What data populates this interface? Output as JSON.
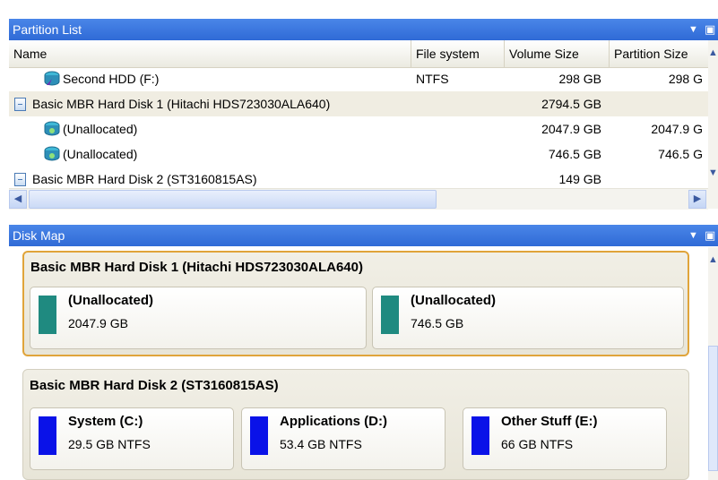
{
  "partition_list": {
    "title": "Partition List",
    "columns": [
      "Name",
      "File system",
      "Volume Size",
      "Partition Size"
    ],
    "rows": [
      {
        "name": "Second HDD (F:)",
        "kind": "partition",
        "fs": "NTFS",
        "volume": "298 GB",
        "partition": "298 G"
      },
      {
        "name": "Basic MBR Hard Disk 1 (Hitachi HDS723030ALA640)",
        "kind": "disk",
        "fs": "",
        "volume": "2794.5 GB",
        "partition": ""
      },
      {
        "name": "(Unallocated)",
        "kind": "partition",
        "fs": "",
        "volume": "2047.9 GB",
        "partition": "2047.9 G"
      },
      {
        "name": "(Unallocated)",
        "kind": "partition",
        "fs": "",
        "volume": "746.5 GB",
        "partition": "746.5 G"
      },
      {
        "name": "Basic MBR Hard Disk 2 (ST3160815AS)",
        "kind": "disk",
        "fs": "",
        "volume": "149 GB",
        "partition": ""
      }
    ]
  },
  "disk_map": {
    "title": "Disk Map",
    "disks": [
      {
        "name": "Basic MBR Hard Disk 1 (Hitachi HDS723030ALA640)",
        "partitions": [
          {
            "name": "(Unallocated)",
            "info": "2047.9 GB",
            "color": "#1f8a80"
          },
          {
            "name": "(Unallocated)",
            "info": "746.5 GB",
            "color": "#1f8a80"
          }
        ]
      },
      {
        "name": "Basic MBR Hard Disk 2 (ST3160815AS)",
        "partitions": [
          {
            "name": "System (C:)",
            "info": "29.5 GB NTFS",
            "color": "#0a12e8"
          },
          {
            "name": "Applications (D:)",
            "info": "53.4 GB NTFS",
            "color": "#0a12e8"
          },
          {
            "name": "Other Stuff (E:)",
            "info": "66 GB NTFS",
            "color": "#0a12e8"
          }
        ]
      }
    ]
  },
  "colors": {
    "title_bar": "#2f6ad6",
    "selected_disk_border": "#e0a43a",
    "unallocated": "#1f8a80",
    "ntfs": "#0a12e8"
  },
  "icons": {
    "panel_menu": "triangle-down-icon",
    "panel_undock": "dock-icon",
    "disk": "hard-disk-icon",
    "partition": "partition-icon"
  }
}
